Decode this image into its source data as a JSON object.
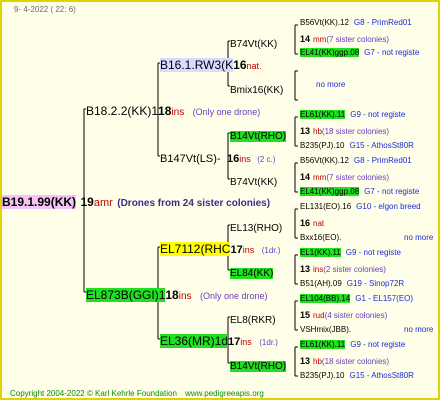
{
  "header": {
    "date": "9-  4-2022 (  22:   6)"
  },
  "root": {
    "name": "B19.1.99(KK)",
    "num": "19",
    "ins": "amr",
    "note": "(Drones from 24 sister colonies)"
  },
  "gen1": [
    {
      "name": "B18.2.2(KK)1",
      "num": "18",
      "ins": "ins",
      "note": "(Only one drone)"
    },
    {
      "name": "EL873B(GGI)1",
      "num": "18",
      "ins": "ins",
      "note": "(Only one drone)"
    }
  ],
  "gen2": [
    {
      "name": "B16.1.RW3(K",
      "num": "16",
      "ins": "nat."
    },
    {
      "name": "B147Vt(LS)-",
      "num": "16",
      "ins": "ins",
      "note": "(2 c.)"
    },
    {
      "name": "EL7112(RHC",
      "num": "17",
      "ins": "ins",
      "note": "(1dr.)"
    },
    {
      "name": "EL36(MR)1d",
      "num": "17",
      "ins": "ins",
      "note": "(1dr.)"
    }
  ],
  "gen3": [
    {
      "name": "B74Vt(KK)"
    },
    {
      "name": "Bmix16(KK)"
    },
    {
      "name": "B14Vt(RHO)"
    },
    {
      "name": "B74Vt(KK)"
    },
    {
      "name": "EL13(RHO)"
    },
    {
      "name": "EL84(KK)"
    },
    {
      "name": "EL8(RKR)"
    },
    {
      "name": "B14Vt(RHO)"
    }
  ],
  "gen4": [
    {
      "a": "B56Vt(KK).12",
      "b": "G8 - PrimRed01",
      "hl": false
    },
    {
      "num": "14",
      "ins": "mm",
      "note": "(7 sister colonies)"
    },
    {
      "a": "EL41(KK)ggp.08",
      "b": "G7 - not registe",
      "hl": true
    },
    {
      "a": "no more",
      "b": "",
      "blue": true,
      "indent": true
    },
    {
      "a": "EL61(KK).11",
      "b": "G9 - not registe",
      "hl": true
    },
    {
      "num": "13",
      "ins": "hb",
      "note": "(18 sister colonies)"
    },
    {
      "a": "B235(PJ).10",
      "b": "G15 - AthosSt80R",
      "hl": false
    },
    {
      "a": "B56Vt(KK).12",
      "b": "G8 - PrimRed01",
      "hl": false
    },
    {
      "num": "14",
      "ins": "mm",
      "note": "(7 sister colonies)"
    },
    {
      "a": "EL41(KK)ggp.08",
      "b": "G7 - not registe",
      "hl": true
    },
    {
      "a": "EL131(EO).16",
      "b": "G10 - elgon breed",
      "hl": false
    },
    {
      "num": "16",
      "ins": "nat",
      "note": ""
    },
    {
      "a": "Bxx16(EO).",
      "b": "no more",
      "hl": false,
      "bblue": true
    },
    {
      "a": "EL1(KK).11",
      "b": "G9 - not registe",
      "hl": true
    },
    {
      "num": "13",
      "ins": "ins",
      "note": "(2 sister colonies)"
    },
    {
      "a": "B51(AH).09",
      "b": "G19 - Sinop72R",
      "hl": false
    },
    {
      "a": "EL104(BB).14",
      "b": "G1 - EL157(EO)",
      "hl": true
    },
    {
      "num": "15",
      "ins": "rud",
      "note": "(4 sister colonies)"
    },
    {
      "a": "VSHmix(JBB).",
      "b": "no more",
      "hl": false,
      "bblue": true
    },
    {
      "a": "EL61(KK).11",
      "b": "G9 - not registe",
      "hl": true
    },
    {
      "num": "13",
      "ins": "hb",
      "note": "(18 sister colonies)"
    },
    {
      "a": "B235(PJ).10",
      "b": "G15 - AthosSt80R",
      "hl": false
    }
  ],
  "footer": {
    "copyright": "Copyright 2004-2022 © Karl Kehrle Foundation",
    "site": "www.pedigreeapis.org"
  }
}
